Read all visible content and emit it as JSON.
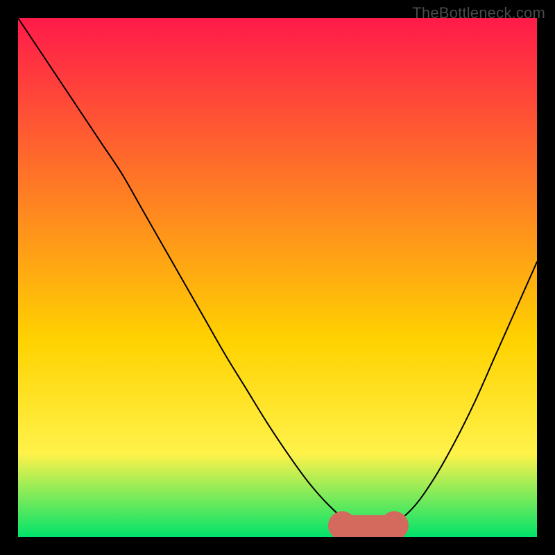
{
  "watermark": "TheBottleneck.com",
  "colors": {
    "gradient_top": "#ff1a4a",
    "gradient_mid1": "#ff8a1f",
    "gradient_mid2": "#ffd200",
    "gradient_mid3": "#fff24a",
    "gradient_bottom": "#00e36a",
    "curve": "#000000",
    "optimal_marker": "#d46a5e"
  },
  "chart_data": {
    "type": "line",
    "title": "",
    "xlabel": "",
    "ylabel": "",
    "xlim": [
      0,
      100
    ],
    "ylim": [
      0,
      100
    ],
    "series": [
      {
        "name": "bottleneck-curve",
        "x": [
          0,
          4,
          8,
          12,
          16,
          20,
          24,
          28,
          32,
          36,
          40,
          44,
          48,
          52,
          56,
          60,
          64,
          66,
          68,
          70,
          72,
          76,
          80,
          84,
          88,
          92,
          96,
          100
        ],
        "values": [
          100,
          94,
          88,
          82,
          76,
          70,
          63,
          56,
          49,
          42,
          35,
          28.5,
          22,
          16,
          10.5,
          6,
          2.5,
          1.6,
          1.5,
          1.5,
          2.2,
          5.5,
          11,
          18,
          26,
          35,
          44,
          53
        ]
      }
    ],
    "optimal_range_x": [
      62.5,
      72.5
    ],
    "optimal_y": 1.5
  }
}
